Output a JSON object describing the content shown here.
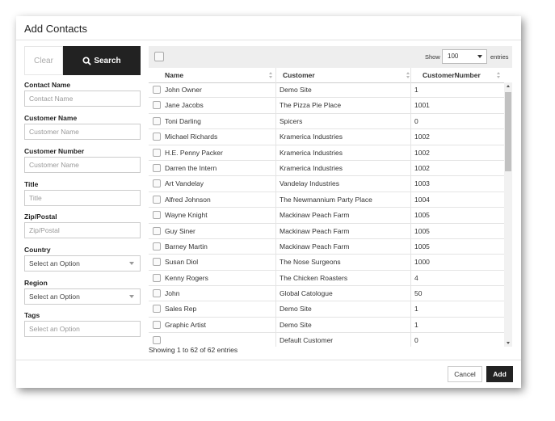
{
  "dialog": {
    "title": "Add Contacts"
  },
  "filters": {
    "clear_label": "Clear",
    "search_label": "Search",
    "contact_name": {
      "label": "Contact Name",
      "placeholder": "Contact Name"
    },
    "customer_name": {
      "label": "Customer Name",
      "placeholder": "Customer Name"
    },
    "customer_number": {
      "label": "Customer Number",
      "placeholder": "Customer Name"
    },
    "title": {
      "label": "Title",
      "placeholder": "Title"
    },
    "zip": {
      "label": "Zip/Postal",
      "placeholder": "Zip/Postal"
    },
    "country": {
      "label": "Country",
      "value": "Select an Option"
    },
    "region": {
      "label": "Region",
      "value": "Select an Option"
    },
    "tags": {
      "label": "Tags",
      "placeholder": "Select an Option"
    }
  },
  "table": {
    "show_label": "Show",
    "page_size": "100",
    "entries_label": "entries",
    "columns": [
      "Name",
      "Customer",
      "CustomerNumber"
    ],
    "rows": [
      [
        "John Owner",
        "Demo Site",
        "1"
      ],
      [
        "Jane Jacobs",
        "The Pizza Pie Place",
        "1001"
      ],
      [
        "Toni Darling",
        "Spicers",
        "0"
      ],
      [
        "Michael Richards",
        "Kramerica Industries",
        "1002"
      ],
      [
        "H.E. Penny Packer",
        "Kramerica Industries",
        "1002"
      ],
      [
        "Darren the Intern",
        "Kramerica Industries",
        "1002"
      ],
      [
        "Art Vandelay",
        "Vandelay Industries",
        "1003"
      ],
      [
        "Alfred Johnson",
        "The Newmannium Party Place",
        "1004"
      ],
      [
        "Wayne Knight",
        "Mackinaw Peach Farm",
        "1005"
      ],
      [
        "Guy Siner",
        "Mackinaw Peach Farm",
        "1005"
      ],
      [
        "Barney Martin",
        "Mackinaw Peach Farm",
        "1005"
      ],
      [
        "Susan Diol",
        "The Nose Surgeons",
        "1000"
      ],
      [
        "Kenny Rogers",
        "The Chicken Roasters",
        "4"
      ],
      [
        "John",
        "Global Catologue",
        "50"
      ],
      [
        "Sales Rep",
        "Demo Site",
        "1"
      ],
      [
        "Graphic Artist",
        "Demo Site",
        "1"
      ],
      [
        "",
        "Default Customer",
        "0"
      ]
    ],
    "info": "Showing 1 to 62 of 62 entries"
  },
  "actions": {
    "cancel_label": "Cancel",
    "add_label": "Add"
  }
}
